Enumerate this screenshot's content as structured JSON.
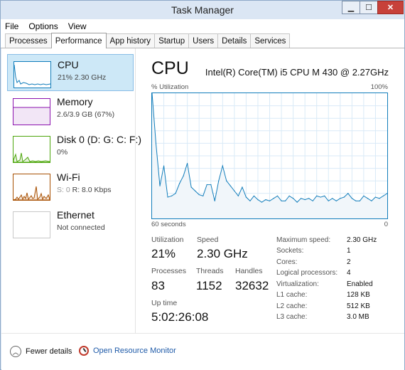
{
  "window": {
    "title": "Task Manager"
  },
  "menu": [
    "File",
    "Options",
    "View"
  ],
  "tabs": [
    "Processes",
    "Performance",
    "App history",
    "Startup",
    "Users",
    "Details",
    "Services"
  ],
  "sidebar": [
    {
      "name": "CPU",
      "sub": "21%  2.30 GHz"
    },
    {
      "name": "Memory",
      "sub": "2.6/3.9 GB (67%)"
    },
    {
      "name": "Disk 0 (D: G: C: F:)",
      "sub": "0%"
    },
    {
      "name": "Wi-Fi",
      "sub_s": "S: 0",
      "sub_r": " R: 8.0 Kbps"
    },
    {
      "name": "Ethernet",
      "sub": "Not connected"
    }
  ],
  "cpu": {
    "title": "CPU",
    "model": "Intel(R) Core(TM) i5 CPU M 430 @ 2.27GHz",
    "graph": {
      "label_top_left": "% Utilization",
      "label_top_right": "100%",
      "label_bottom_left": "60 seconds",
      "label_bottom_right": "0"
    }
  },
  "stats": {
    "utilization_label": "Utilization",
    "utilization": "21%",
    "speed_label": "Speed",
    "speed": "2.30 GHz",
    "processes_label": "Processes",
    "processes": "83",
    "threads_label": "Threads",
    "threads": "1152",
    "handles_label": "Handles",
    "handles": "32632",
    "uptime_label": "Up time",
    "uptime": "5:02:26:08"
  },
  "specs": [
    {
      "key": "Maximum speed:",
      "val": "2.30 GHz"
    },
    {
      "key": "Sockets:",
      "val": "1"
    },
    {
      "key": "Cores:",
      "val": "2"
    },
    {
      "key": "Logical processors:",
      "val": "4"
    },
    {
      "key": "Virtualization:",
      "val": "Enabled"
    },
    {
      "key": "L1 cache:",
      "val": "128 KB"
    },
    {
      "key": "L2 cache:",
      "val": "512 KB"
    },
    {
      "key": "L3 cache:",
      "val": "3.0 MB"
    }
  ],
  "footer": {
    "fewer_details": "Fewer details",
    "open_monitor": "Open Resource Monitor"
  },
  "colors": {
    "cpu": "#117dbb",
    "memory": "#8b12ae",
    "disk": "#4da60c",
    "wifi": "#a74f01",
    "selected_bg": "#cde8f7"
  },
  "chart_data": {
    "type": "area",
    "title": "% Utilization",
    "xlabel": "60 seconds",
    "ylim": [
      0,
      100
    ],
    "values": [
      100,
      60,
      26,
      42,
      17,
      18,
      20,
      28,
      34,
      44,
      25,
      22,
      19,
      18,
      27,
      27,
      14,
      30,
      42,
      30,
      26,
      22,
      18,
      25,
      17,
      14,
      18,
      15,
      13,
      15,
      14,
      16,
      18,
      14,
      14,
      18,
      16,
      13,
      16,
      15,
      16,
      14,
      18,
      17,
      18,
      14,
      16,
      14,
      16,
      17,
      20,
      16,
      14,
      14,
      18,
      16,
      14,
      17,
      16,
      18,
      20
    ]
  }
}
